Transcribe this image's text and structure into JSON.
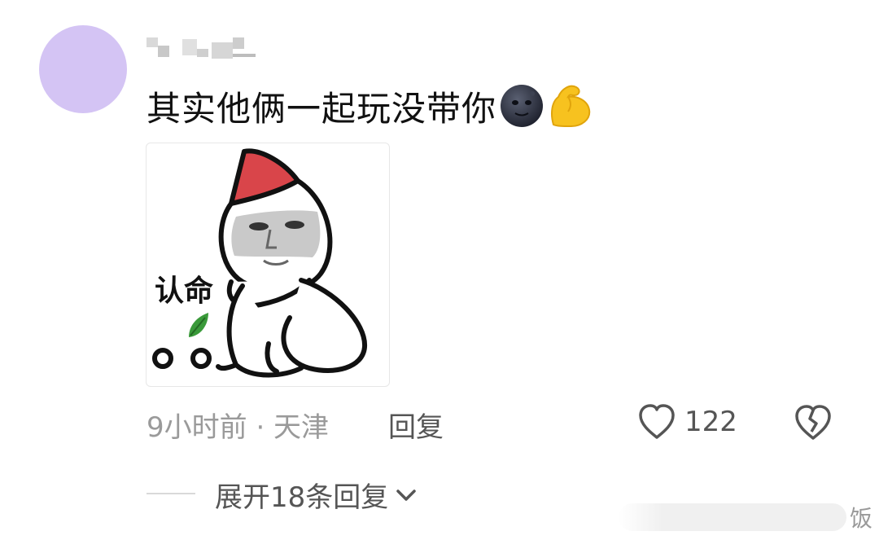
{
  "comment": {
    "avatar_color": "#d4c4f4",
    "username": "",
    "text": "其实他俩一起玩没带你",
    "emojis": [
      "new-moon-face-emoji",
      "flexed-biceps-emoji"
    ]
  },
  "sticker": {
    "caption": "认命"
  },
  "meta": {
    "time_location": "9小时前 · 天津",
    "reply_label": "回复",
    "like_count": "122"
  },
  "expand": {
    "label": "展开18条回复"
  },
  "watermark": {
    "text": "饭"
  },
  "colors": {
    "meta_gray": "#9a9a9a",
    "action_gray": "#555555",
    "hat_red": "#d9454a",
    "muscle_yellow": "#f7c21f"
  }
}
